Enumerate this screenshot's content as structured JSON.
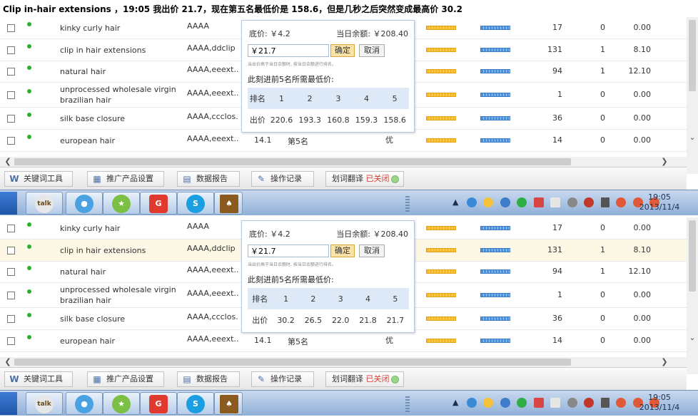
{
  "caption": "Clip in-hair extensions ，19:05 我出价 21.7，现在第五名最低价是 158.6，但是几秒之后突然变成最高价 30.2",
  "colors": {
    "toolbar_off": "#d83a2e",
    "highlight_row": "#fdf8e6",
    "online_dot": "#2bb02b"
  },
  "toolbar": {
    "keyword_tool": "关键词工具",
    "promo_settings": "推广产品设置",
    "data_report": "数据报告",
    "operation_log": "操作记录",
    "translate": "划词翻译",
    "translate_status": "已关闭"
  },
  "taskbar": {
    "time": "19:05",
    "date": "2013/11/4"
  },
  "rows": [
    {
      "keyword": "kinky curly hair",
      "group": "AAAA",
      "v1": "17",
      "v2": "0",
      "v3": "0.00"
    },
    {
      "keyword": "clip in hair extensions",
      "group": "AAAA,ddclip",
      "v1": "131",
      "v2": "1",
      "v3": "8.10"
    },
    {
      "keyword": "natural hair",
      "group": "AAAA,eeext...",
      "v1": "94",
      "v2": "1",
      "v3": "12.10"
    },
    {
      "keyword": "unprocessed wholesale virgin brazilian hair",
      "group": "AAAA,eeext...",
      "v1": "1",
      "v2": "0",
      "v3": "0.00"
    },
    {
      "keyword": "silk base closure",
      "group": "AAAA,ccclos...",
      "v1": "36",
      "v2": "0",
      "v3": "0.00"
    },
    {
      "keyword": "european hair",
      "group": "AAAA,eeext...",
      "bid": "14.1",
      "rank": "第5名",
      "quality": "优",
      "v1": "14",
      "v2": "0",
      "v3": "0.00"
    }
  ],
  "popup_top": {
    "base_price": "底价: ￥4.2",
    "balance": "当日余额: ￥208.40",
    "bid_value": "￥21.7",
    "ok": "确定",
    "cancel": "取消",
    "hint": "当出价高于当日余额时, 按当日余额进行排名。",
    "need_label": "此刻进前5名所需最低价:",
    "rank_header": "排名",
    "ranks": [
      "1",
      "2",
      "3",
      "4",
      "5"
    ],
    "price_header": "出价",
    "prices": [
      "220.6",
      "193.3",
      "160.8",
      "159.3",
      "158.6"
    ]
  },
  "popup_bottom": {
    "base_price": "底价: ￥4.2",
    "balance": "当日余额: ￥208.40",
    "bid_value": "￥21.7",
    "ok": "确定",
    "cancel": "取消",
    "hint": "当出价高于当日余额时, 按当日余额进行排名。",
    "need_label": "此刻进前5名所需最低价:",
    "rank_header": "排名",
    "ranks": [
      "1",
      "2",
      "3",
      "4",
      "5"
    ],
    "price_header": "出价",
    "prices": [
      "30.2",
      "26.5",
      "22.0",
      "21.8",
      "21.7"
    ]
  },
  "icons": [
    "keyword-tool-icon",
    "settings-icon",
    "report-icon",
    "log-icon",
    "status-green-icon",
    "talk-icon",
    "skype-icon"
  ]
}
